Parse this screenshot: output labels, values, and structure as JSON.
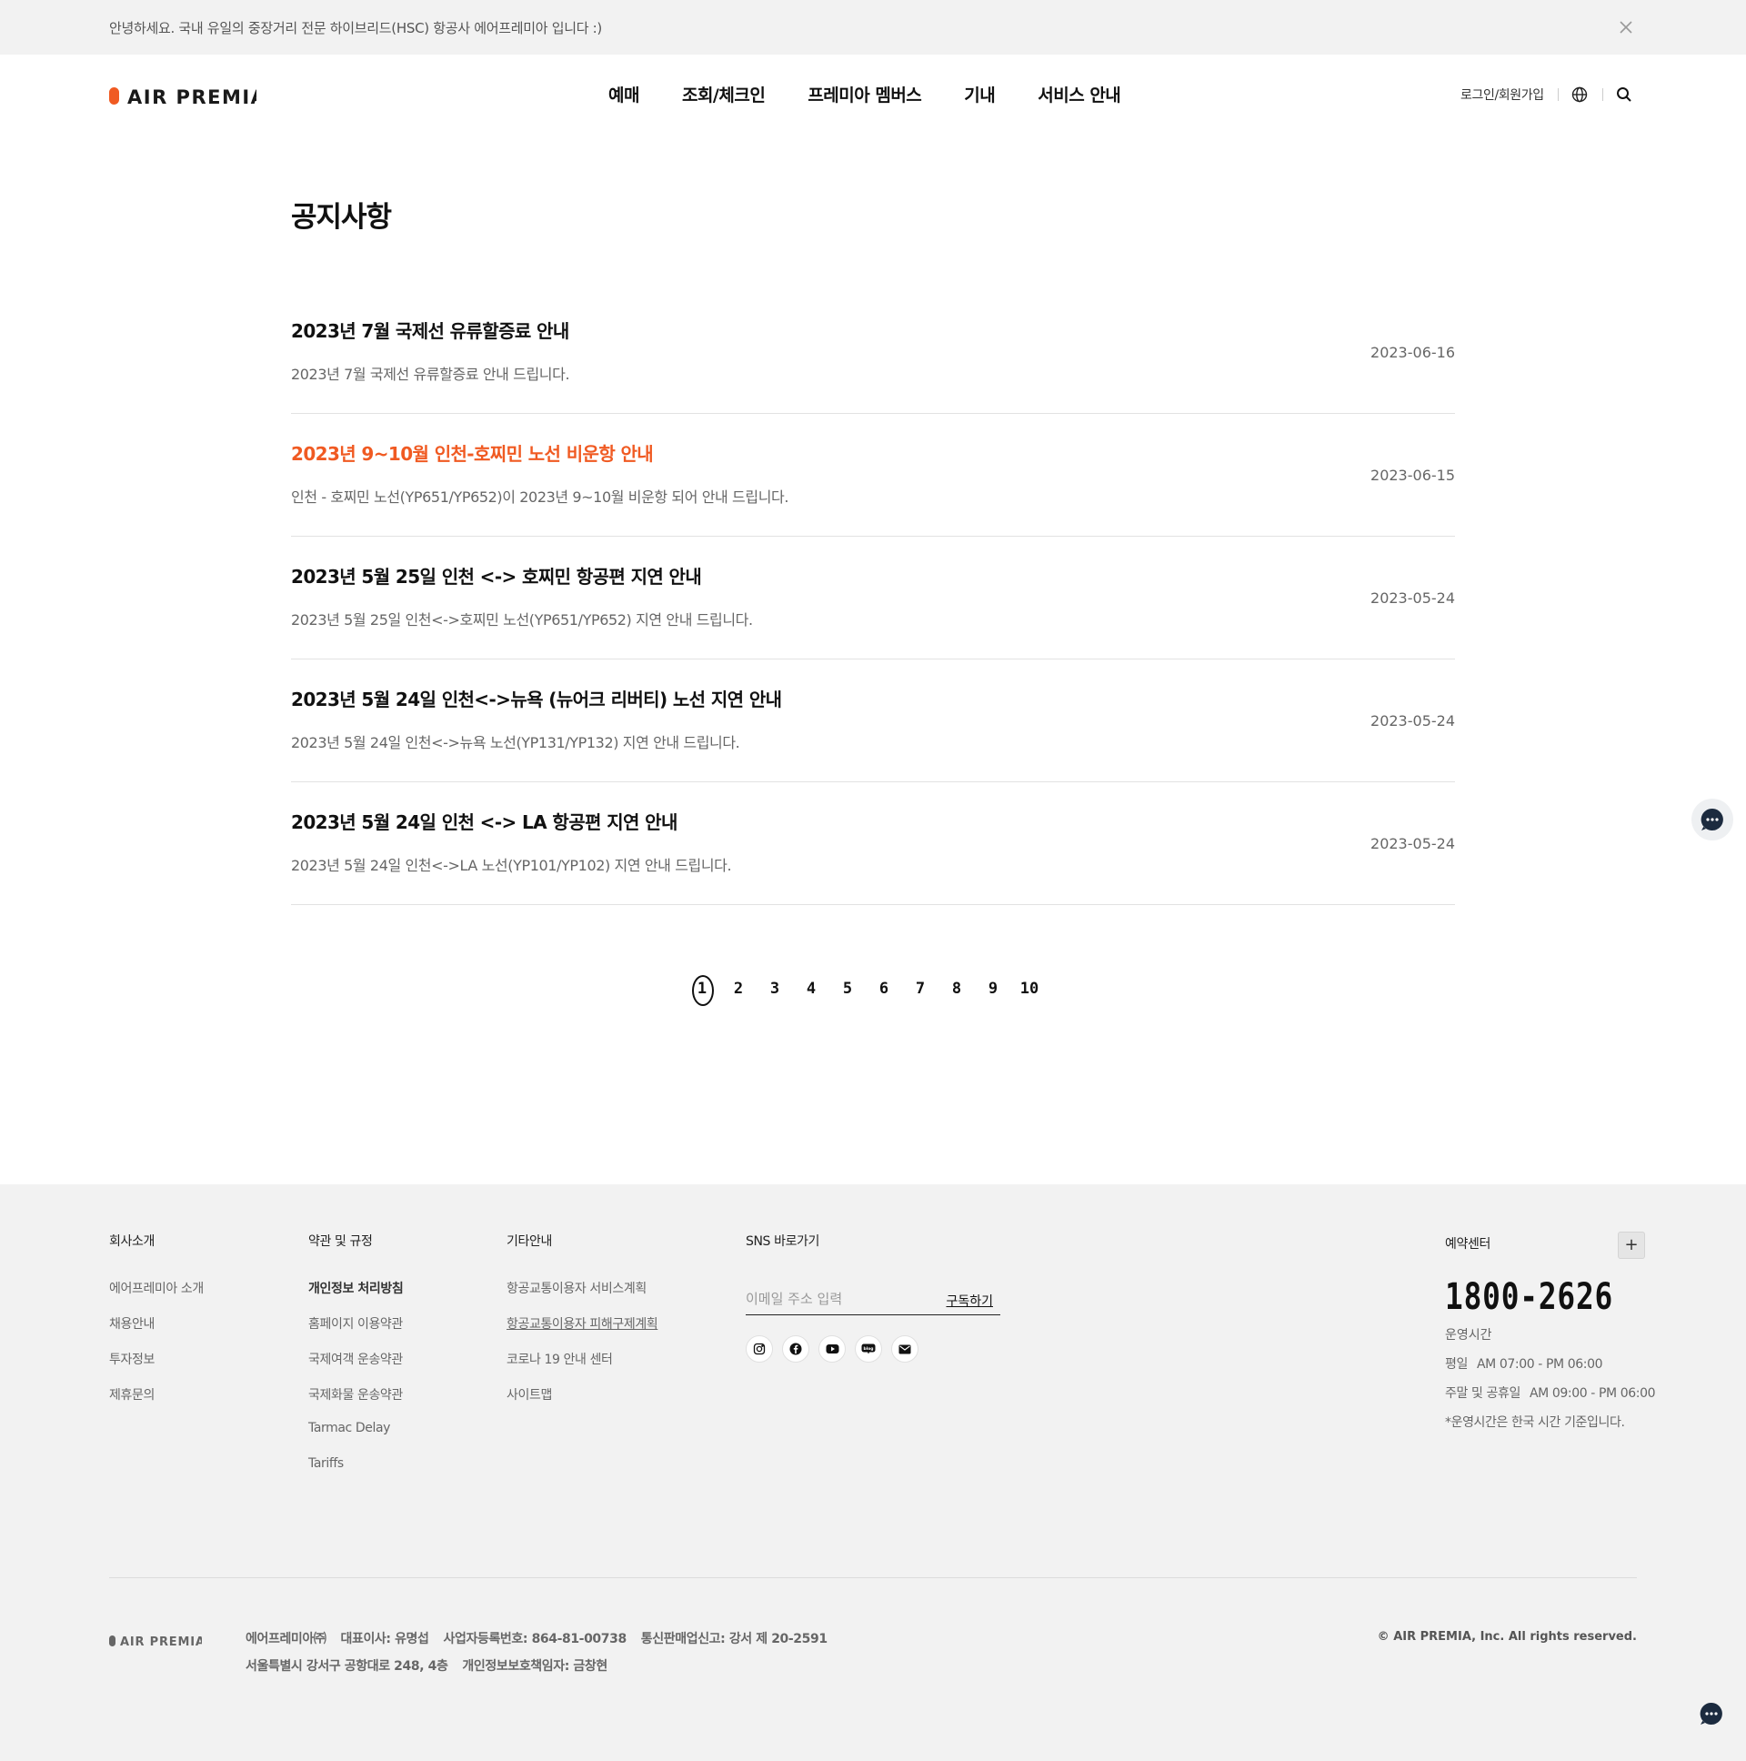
{
  "notice_bar": {
    "text": "안녕하세요. 국내 유일의 중장거리 전문 하이브리드(HSC) 항공사 에어프레미아 입니다 :)"
  },
  "header": {
    "logo_text": "AIR PREMIA",
    "nav": [
      "예매",
      "조회/체크인",
      "프레미아 멤버스",
      "기내",
      "서비스 안내"
    ],
    "login_label": "로그인/회원가입"
  },
  "main": {
    "title": "공지사항",
    "notices": [
      {
        "title": "2023년 7월 국제선 유류할증료 안내",
        "desc": "2023년 7월 국제선 유류할증료 안내 드립니다.",
        "date": "2023-06-16",
        "highlighted": false
      },
      {
        "title": "2023년 9~10월 인천-호찌민 노선 비운항 안내",
        "desc": "인천 - 호찌민 노선(YP651/YP652)이 2023년 9~10월 비운항 되어 안내 드립니다.",
        "date": "2023-06-15",
        "highlighted": true
      },
      {
        "title": "2023년 5월 25일 인천 <-> 호찌민 항공편 지연 안내",
        "desc": "2023년 5월 25일 인천<->호찌민 노선(YP651/YP652) 지연 안내 드립니다.",
        "date": "2023-05-24",
        "highlighted": false
      },
      {
        "title": "2023년 5월 24일 인천<->뉴욕 (뉴어크 리버티) 노선 지연 안내",
        "desc": "2023년 5월 24일 인천<->뉴욕 노선(YP131/YP132) 지연 안내 드립니다.",
        "date": "2023-05-24",
        "highlighted": false
      },
      {
        "title": "2023년 5월 24일 인천 <-> LA 항공편 지연 안내",
        "desc": "2023년 5월 24일 인천<->LA 노선(YP101/YP102) 지연 안내 드립니다.",
        "date": "2023-05-24",
        "highlighted": false
      }
    ],
    "highlight_color": "#f05a22"
  },
  "pagination": {
    "pages": [
      "1",
      "2",
      "3",
      "4",
      "5",
      "6",
      "7",
      "8",
      "9",
      "10"
    ],
    "current": "1"
  },
  "footer": {
    "columns": [
      {
        "title": "회사소개",
        "links": [
          "에어프레미아 소개",
          "채용안내",
          "투자정보",
          "제휴문의"
        ]
      },
      {
        "title": "약관 및 규정",
        "links": [
          "개인정보 처리방침",
          "홈페이지 이용약관",
          "국제여객 운송약관",
          "국제화물 운송약관",
          "Tarmac Delay",
          "Tariffs"
        ]
      },
      {
        "title": "기타안내",
        "links": [
          "항공교통이용자 서비스계획",
          "항공교통이용자 피해구제계획",
          "코로나 19 안내 센터",
          "사이트맵"
        ]
      }
    ],
    "sns": {
      "title": "SNS 바로가기",
      "email_placeholder": "이메일 주소 입력",
      "subscribe_label": "구독하기",
      "icons": [
        "instagram-icon",
        "facebook-icon",
        "youtube-icon",
        "blog-icon",
        "mail-icon"
      ]
    },
    "call_center": {
      "title": "예약센터",
      "toggle": "+",
      "number": "1800-2626",
      "hours_label": "운영시간",
      "weekday_label": "평일",
      "weekday_hours": "AM 07:00 - PM 06:00",
      "weekend_label": "주말 및 공휴일",
      "weekend_hours": "AM 09:00 - PM 06:00",
      "note": "*운영시간은 한국 시간 기준입니다."
    },
    "company": {
      "logo_text": "AIR PREMIA",
      "name": "에어프레미아㈜",
      "ceo": "대표이사: 유명섭",
      "biz_no": "사업자등록번호: 864-81-00738",
      "ecommerce": "통신판매업신고: 강서 제 20-2591",
      "address": "서울특별시 강서구 공항대로 248, 4층",
      "privacy_officer": "개인정보보호책임자: 금창현"
    },
    "copyright": "© AIR PREMIA, Inc. All rights reserved."
  },
  "colors": {
    "brand_orange": "#f05a22",
    "chat_navy": "#1c2b3f"
  }
}
